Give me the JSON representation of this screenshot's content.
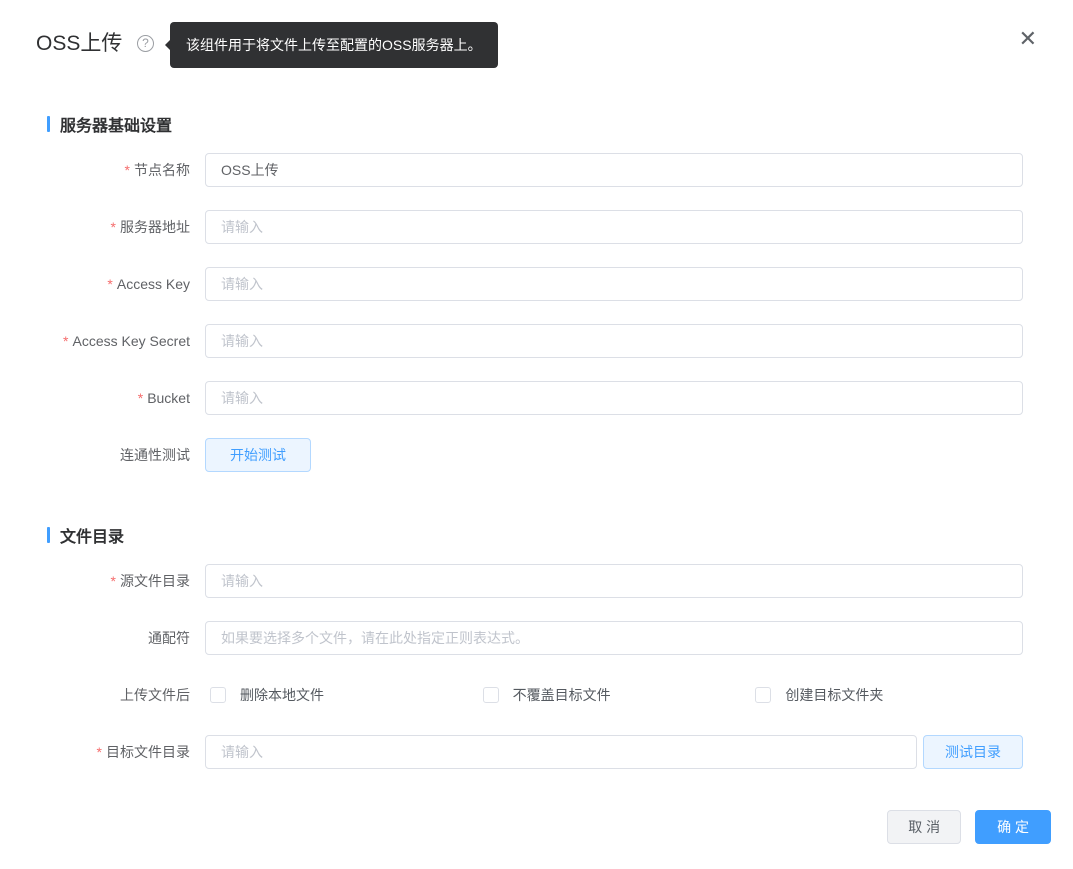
{
  "header": {
    "title": "OSS上传",
    "help_icon_glyph": "?",
    "help_tooltip": "该组件用于将文件上传至配置的OSS服务器上。",
    "close_glyph": "✕"
  },
  "sections": {
    "server": {
      "title": "服务器基础设置"
    },
    "directory": {
      "title": "文件目录"
    }
  },
  "fields": {
    "node_name": {
      "label": "节点名称",
      "required_mark": "*",
      "value": "OSS上传"
    },
    "server_address": {
      "label": "服务器地址",
      "required_mark": "*",
      "placeholder": "请输入"
    },
    "access_key": {
      "label": "Access Key",
      "required_mark": "*",
      "placeholder": "请输入"
    },
    "access_key_secret": {
      "label": "Access Key Secret",
      "required_mark": "*",
      "placeholder": "请输入"
    },
    "bucket": {
      "label": "Bucket",
      "required_mark": "*",
      "placeholder": "请输入"
    },
    "connectivity_test": {
      "label": "连通性测试",
      "button_label": "开始测试"
    },
    "source_dir": {
      "label": "源文件目录",
      "required_mark": "*",
      "placeholder": "请输入"
    },
    "wildcard": {
      "label": "通配符",
      "placeholder": "如果要选择多个文件，请在此处指定正则表达式。"
    },
    "after_upload": {
      "label": "上传文件后",
      "options": [
        {
          "label": "删除本地文件",
          "checked": false
        },
        {
          "label": "不覆盖目标文件",
          "checked": false
        },
        {
          "label": "创建目标文件夹",
          "checked": false
        }
      ]
    },
    "target_dir": {
      "label": "目标文件目录",
      "required_mark": "*",
      "placeholder": "请输入",
      "button_label": "测试目录"
    }
  },
  "footer": {
    "cancel_label": "取 消",
    "confirm_label": "确 定"
  },
  "colors": {
    "accent": "#409eff",
    "required": "#f56c6c",
    "tooltip_bg": "#303133",
    "light_button_bg": "#ecf5ff",
    "light_button_border": "#b3d8ff",
    "input_border": "#dcdfe6",
    "placeholder": "#c0c4cc"
  }
}
